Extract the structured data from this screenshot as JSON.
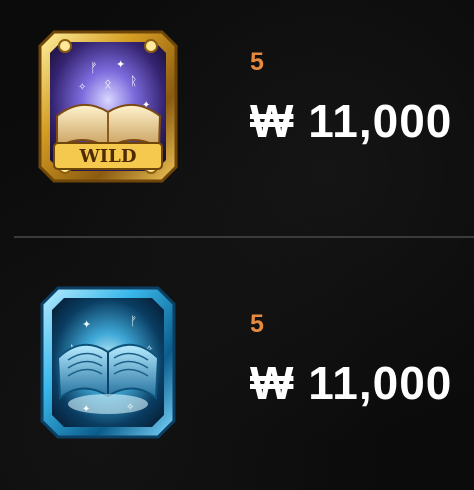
{
  "paytable": {
    "rows": [
      {
        "symbol_icon": "wild-spellbook-icon",
        "symbol_text": "WILD",
        "count": "5",
        "payout": "₩ 11,000"
      },
      {
        "symbol_icon": "scatter-spellbook-icon",
        "count": "5",
        "payout": "₩ 11,000"
      }
    ]
  },
  "colors": {
    "background": "#0b0b0b",
    "count_orange": "#e58a3f",
    "payout_white": "#ffffff",
    "divider": "#3b3b3b",
    "wild_gold": "#d4a52e",
    "scatter_blue": "#39b7ea"
  }
}
